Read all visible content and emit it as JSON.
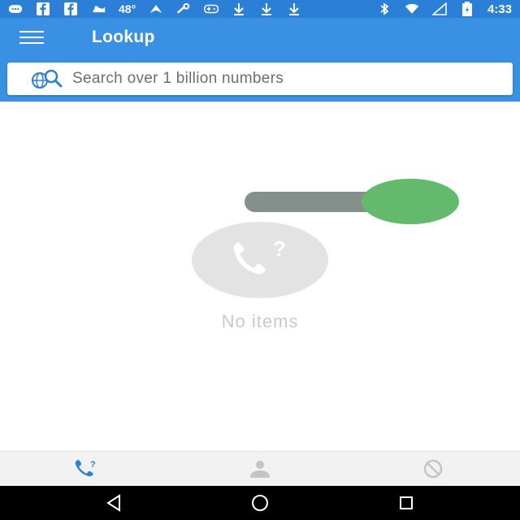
{
  "status_bar": {
    "temperature": "48°",
    "time": "4:33",
    "left_icons": [
      "message-icon",
      "facebook-icon",
      "facebook-icon",
      "weather-icon",
      "temperature-text",
      "nav-icon",
      "wrench-icon",
      "gamepad-icon",
      "download-icon",
      "download-icon",
      "download-icon"
    ],
    "right_icons": [
      "bluetooth-icon",
      "wifi-icon",
      "signal-icon",
      "battery-icon"
    ]
  },
  "app_bar": {
    "title": "Lookup",
    "accent_color": "#3a91e3"
  },
  "search": {
    "placeholder": "Search over 1 billion numbers"
  },
  "content": {
    "empty_text": "No items",
    "empty_icon": "phone-question-icon"
  },
  "toggle": {
    "state": "on",
    "knob_color": "#63ba6d",
    "track_color": "#858f8c"
  },
  "bottom_nav": {
    "tabs": [
      {
        "name": "calls",
        "icon": "phone-question-icon",
        "active": true,
        "color": "#2b7fd6"
      },
      {
        "name": "contacts",
        "icon": "person-icon",
        "active": false,
        "color": "#c4c4c4"
      },
      {
        "name": "blocked",
        "icon": "block-icon",
        "active": false,
        "color": "#c4c4c4"
      }
    ]
  },
  "system_nav": {
    "buttons": [
      "back-icon",
      "home-icon",
      "recents-icon"
    ]
  }
}
